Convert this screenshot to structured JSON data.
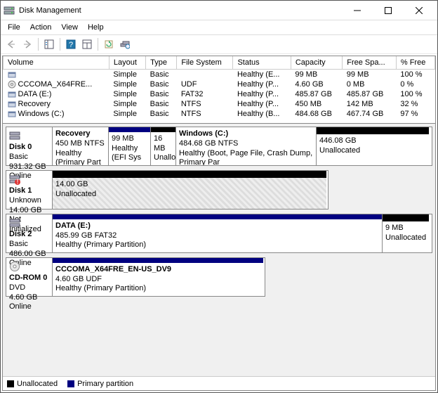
{
  "window": {
    "title": "Disk Management"
  },
  "menu": [
    "File",
    "Action",
    "View",
    "Help"
  ],
  "columns": [
    "Volume",
    "Layout",
    "Type",
    "File System",
    "Status",
    "Capacity",
    "Free Spa...",
    "% Free"
  ],
  "volumes": [
    {
      "name": "",
      "layout": "Simple",
      "type": "Basic",
      "fs": "",
      "status": "Healthy (E...",
      "capacity": "99 MB",
      "free": "99 MB",
      "pct": "100 %",
      "icon": "vol"
    },
    {
      "name": "CCCOMA_X64FRE...",
      "layout": "Simple",
      "type": "Basic",
      "fs": "UDF",
      "status": "Healthy (P...",
      "capacity": "4.60 GB",
      "free": "0 MB",
      "pct": "0 %",
      "icon": "disc"
    },
    {
      "name": "DATA (E:)",
      "layout": "Simple",
      "type": "Basic",
      "fs": "FAT32",
      "status": "Healthy (P...",
      "capacity": "485.87 GB",
      "free": "485.87 GB",
      "pct": "100 %",
      "icon": "vol"
    },
    {
      "name": "Recovery",
      "layout": "Simple",
      "type": "Basic",
      "fs": "NTFS",
      "status": "Healthy (P...",
      "capacity": "450 MB",
      "free": "142 MB",
      "pct": "32 %",
      "icon": "vol"
    },
    {
      "name": "Windows (C:)",
      "layout": "Simple",
      "type": "Basic",
      "fs": "NTFS",
      "status": "Healthy (B...",
      "capacity": "484.68 GB",
      "free": "467.74 GB",
      "pct": "97 %",
      "icon": "vol"
    }
  ],
  "disks": [
    {
      "name": "Disk 0",
      "type": "Basic",
      "size": "931.32 GB",
      "status": "Online",
      "icon": "disk",
      "parts": [
        {
          "title": "Recovery",
          "line2": "450 MB NTFS",
          "line3": "Healthy (Primary Part",
          "bar": "primary",
          "flex": 80
        },
        {
          "title": "",
          "line2": "99 MB",
          "line3": "Healthy (EFI Sys",
          "bar": "primary",
          "flex": 60
        },
        {
          "title": "",
          "line2": "16 MB",
          "line3": "Unalloca",
          "bar": "unalloc",
          "flex": 36
        },
        {
          "title": "Windows  (C:)",
          "line2": "484.68 GB NTFS",
          "line3": "Healthy (Boot, Page File, Crash Dump, Primary Par",
          "bar": "primary",
          "flex": 200
        },
        {
          "title": "",
          "line2": "446.08 GB",
          "line3": "Unallocated",
          "bar": "unalloc",
          "flex": 160
        }
      ]
    },
    {
      "name": "Disk 1",
      "type": "Unknown",
      "size": "14.00 GB",
      "status": "Not Initialized",
      "icon": "disk-warn",
      "parts": [
        {
          "title": "",
          "line2": "14.00 GB",
          "line3": "Unallocated",
          "bar": "unalloc",
          "flex": 390,
          "hatch": true
        }
      ],
      "short": true
    },
    {
      "name": "Disk 2",
      "type": "Basic",
      "size": "486.00 GB",
      "status": "Online",
      "icon": "disk",
      "parts": [
        {
          "title": "DATA  (E:)",
          "line2": "485.99 GB FAT32",
          "line3": "Healthy (Primary Partition)",
          "bar": "primary",
          "flex": 470
        },
        {
          "title": "",
          "line2": "9 MB",
          "line3": "Unallocated",
          "bar": "unalloc",
          "flex": 66
        }
      ]
    },
    {
      "name": "CD-ROM 0",
      "type": "DVD",
      "size": "4.60 GB",
      "status": "Online",
      "icon": "disc",
      "parts": [
        {
          "title": "CCCOMA_X64FRE_EN-US_DV9",
          "line2": "4.60 GB UDF",
          "line3": "Healthy (Primary Partition)",
          "bar": "primary",
          "flex": 300
        }
      ],
      "short": true
    }
  ],
  "legend": [
    {
      "label": "Unallocated",
      "color": "#000"
    },
    {
      "label": "Primary partition",
      "color": "#000080"
    }
  ]
}
